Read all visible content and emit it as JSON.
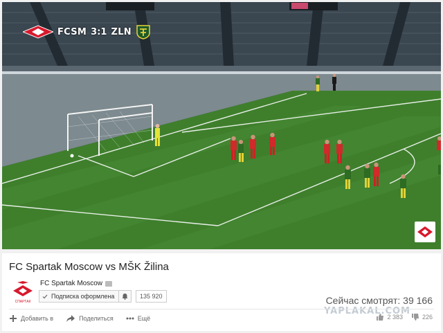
{
  "video": {
    "score": {
      "home": "FCSM",
      "result": "3:1",
      "away": "ZLN"
    }
  },
  "info": {
    "title": "FC Spartak Moscow vs MŠK Žilina",
    "channel_name": "FC Spartak Moscow",
    "channel_logo_text": "СПАРТАК",
    "subscribe_label": "Подписка оформлена",
    "subscriber_count": "135 920",
    "viewers": "Сейчас смотрят: 39 166",
    "actions": {
      "add": "Добавить в",
      "share": "Поделиться",
      "more": "Ещё"
    },
    "likes": "2 383",
    "dislikes": "226",
    "watermark": "YAPLAKAL.COM"
  },
  "colors": {
    "accent": "#d7192d",
    "grass": "#3e7d2b",
    "panel": "#ffffff"
  }
}
